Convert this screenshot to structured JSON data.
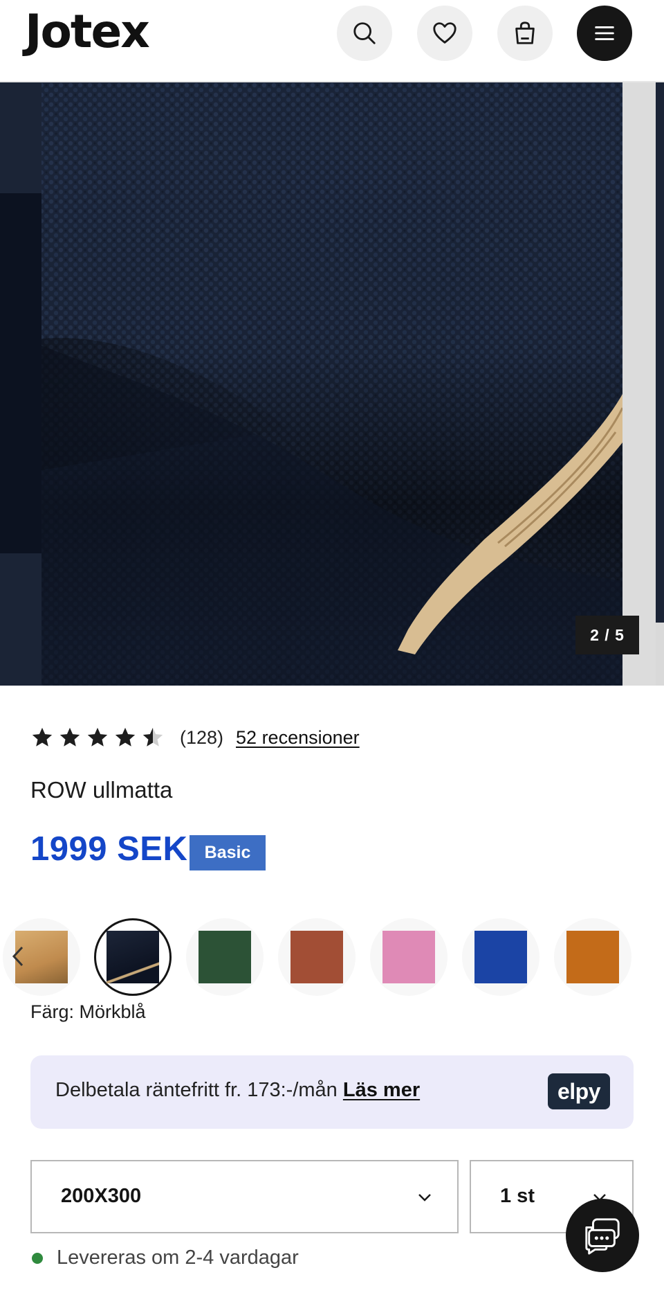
{
  "header": {
    "logo": "Jotex",
    "icons": [
      "search-icon",
      "heart-icon",
      "bag-icon",
      "menu-icon"
    ]
  },
  "gallery": {
    "counter": "2 / 5"
  },
  "product": {
    "rating": 4.5,
    "rating_count": "(128)",
    "reviews_link": "52 recensioner",
    "title": "ROW ullmatta",
    "price": "1999 SEK",
    "badge": "Basic"
  },
  "swatches": {
    "colors": [
      "#c89a5e",
      "#131a2a",
      "#2c5236",
      "#a24e35",
      "#df8ab6",
      "#1b44a5",
      "#c36b19"
    ],
    "selected_index": 1,
    "color_label": "Färg: Mörkblå"
  },
  "payment": {
    "text": "Delbetala räntefritt fr. 173:-/mån ",
    "link": "Läs mer",
    "logo": "elpy"
  },
  "selectors": {
    "size": "200X300",
    "quantity": "1 st"
  },
  "delivery": {
    "text": "Levereras om 2-4 vardagar",
    "status_color": "#2f8a3e"
  },
  "colors": {
    "price": "#1446c8",
    "badge": "#3d6ec4",
    "payment_bg": "#ecebfa"
  }
}
